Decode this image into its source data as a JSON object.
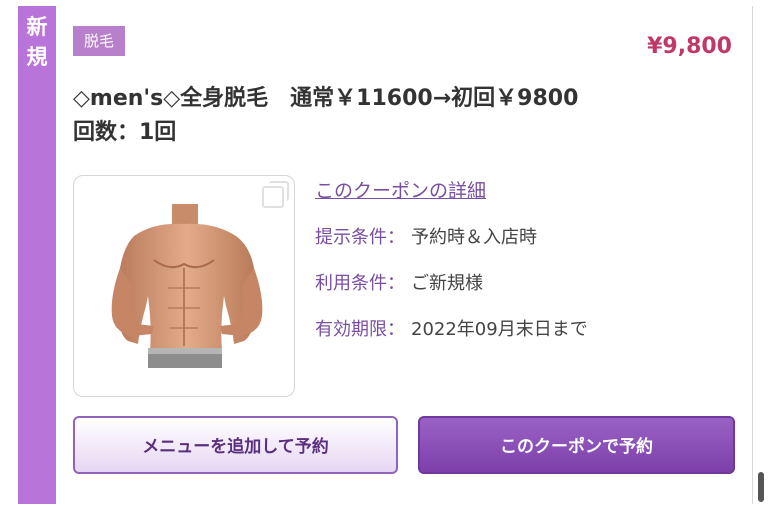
{
  "coupon": {
    "side_tag": [
      "新",
      "規"
    ],
    "category": "脱毛",
    "price": "¥9,800",
    "title_line1": "◇men's◇全身脱毛　通常￥11600→初回￥9800",
    "title_line2": "回数：1回",
    "detail_link": "このクーポンの詳細",
    "details": [
      {
        "key": "提示条件：",
        "value": "予約時＆入店時"
      },
      {
        "key": "利用条件：",
        "value": "ご新規様"
      },
      {
        "key": "有効期限：",
        "value": "2022年09月末日まで"
      }
    ],
    "image_alt": "men-torso-photo"
  },
  "buttons": {
    "add_menu": "メニューを追加して予約",
    "book_coupon": "このクーポンで予約"
  },
  "colors": {
    "accent_purple": "#b874d9",
    "price_red": "#c0386a",
    "button_purple": "#7d40ab"
  }
}
